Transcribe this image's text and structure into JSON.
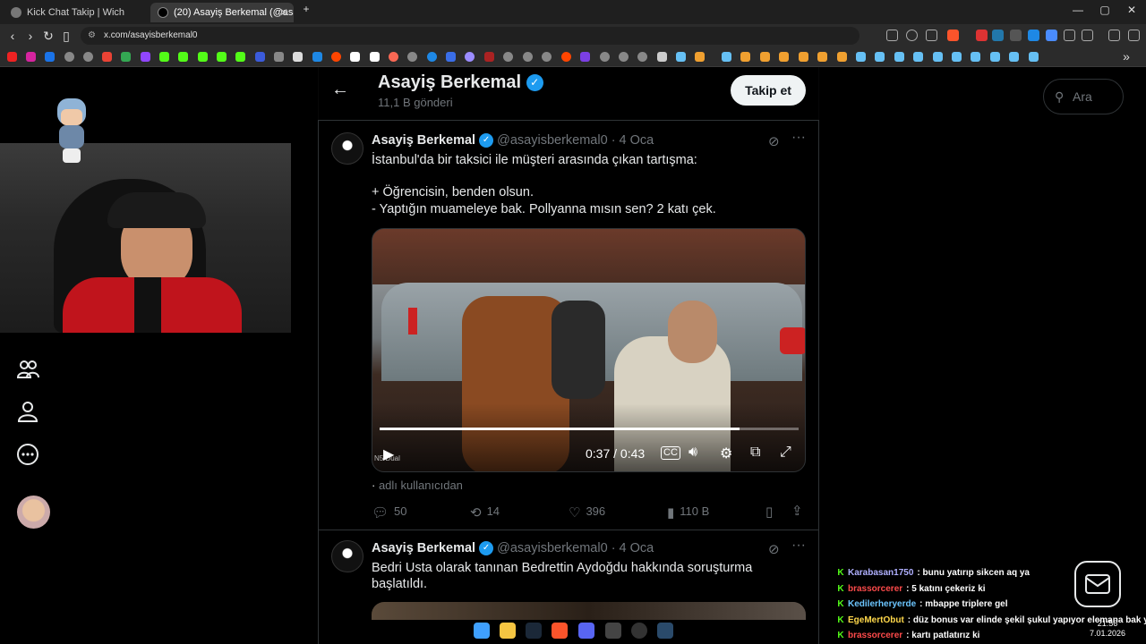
{
  "browser": {
    "tabs": [
      {
        "label": "Kick Chat Takip | Wich",
        "active": false
      },
      {
        "label": "(20) Asayiş Berkemal (@asay...",
        "active": true
      }
    ],
    "new_tab": "+",
    "url": "x.com/asayisberkemal0",
    "win_min": "—",
    "win_max": "▢",
    "win_close": "✕"
  },
  "sidebar": {
    "icons": [
      "communities-icon",
      "profile-icon",
      "more-icon",
      "account-avatar"
    ]
  },
  "profile_header": {
    "back": "←",
    "name": "Asayiş Berkemal",
    "post_count": "11,1 B gönderi",
    "follow_label": "Takip et"
  },
  "search": {
    "placeholder": "Ara"
  },
  "tweets": [
    {
      "name": "Asayiş Berkemal",
      "handle": "@asayisberkemal0",
      "date": "· 4 Oca",
      "text_line1": "İstanbul'da bir taksici ile müşteri arasında çıkan tartışma:",
      "text_line2": "+ Öğrencisin, benden olsun.",
      "text_line3": "- Yaptığın muameleye bak. Pollyanna mısın sen? 2 katı çek.",
      "video": {
        "time": "0:37 / 0:43",
        "progress": 0.86,
        "overlay_text": "N5 Dual"
      },
      "source_caption": "adlı kullanıcıdan",
      "stats": {
        "replies": "50",
        "reposts": "14",
        "likes": "396",
        "views": "110 B"
      }
    },
    {
      "name": "Asayiş Berkemal",
      "handle": "@asayisberkemal0",
      "date": "· 4 Oca",
      "text_line1": "Bedri Usta olarak tanınan Bedrettin Aydoğdu hakkında soruşturma",
      "text_line2": "başlatıldı."
    }
  ],
  "chat": [
    {
      "user": "Karabasan1750",
      "msg": ": bunu yatırıp sikcen aq ya",
      "color": "#b0b0ff"
    },
    {
      "user": "brassorcerer",
      "msg": ": 5 katını çekeriz ki",
      "color": "#ff4b4b"
    },
    {
      "user": "Kedilerheryerde",
      "msg": ": mbappe triplere gel",
      "color": "#6cc6ff"
    },
    {
      "user": "EgeMertObut",
      "msg": ": düz bonus var elinde şekil şukul yapıyor elemana bak ya",
      "color": "#ffd84b"
    },
    {
      "user": "brassorcerer",
      "msg": ": kartı patlatırız ki",
      "color": "#ff4b4b"
    }
  ],
  "clock": {
    "time": "21:56",
    "date": "7.01.2026"
  },
  "colors": {
    "accent": "#1d9bf0",
    "bg": "#000000",
    "muted": "#71767b"
  }
}
